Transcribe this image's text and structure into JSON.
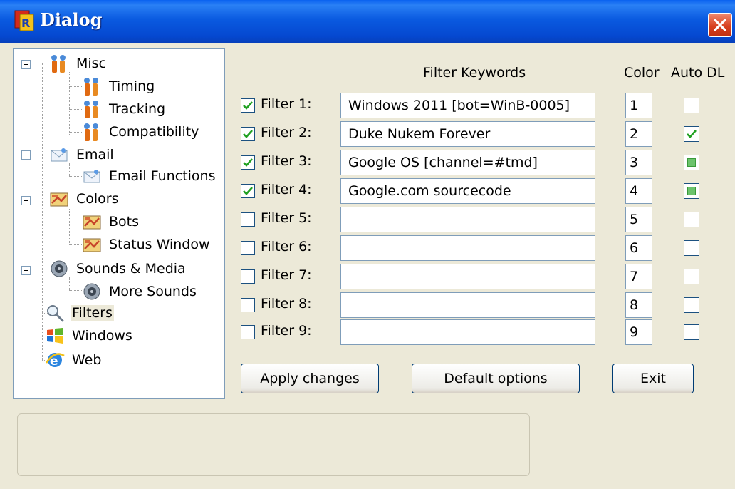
{
  "window": {
    "title": "Dialog"
  },
  "tree": {
    "items": [
      {
        "label": "Misc",
        "icon": "tools-icon"
      },
      {
        "label": "Timing",
        "icon": "tools-icon"
      },
      {
        "label": "Tracking",
        "icon": "tools-icon"
      },
      {
        "label": "Compatibility",
        "icon": "tools-icon"
      },
      {
        "label": "Email",
        "icon": "email-icon"
      },
      {
        "label": "Email Functions",
        "icon": "email-icon"
      },
      {
        "label": "Colors",
        "icon": "colors-icon"
      },
      {
        "label": "Bots",
        "icon": "colors-icon"
      },
      {
        "label": "Status Window",
        "icon": "colors-icon"
      },
      {
        "label": "Sounds & Media",
        "icon": "speaker-icon"
      },
      {
        "label": "More Sounds",
        "icon": "speaker-icon"
      },
      {
        "label": "Filters",
        "icon": "magnifier-icon",
        "selected": true
      },
      {
        "label": "Windows",
        "icon": "windows-flag-icon"
      },
      {
        "label": "Web",
        "icon": "ie-icon"
      }
    ]
  },
  "headers": {
    "keywords": "Filter Keywords",
    "color": "Color",
    "auto_dl": "Auto DL"
  },
  "filters": [
    {
      "label": "Filter 1:",
      "enabled": true,
      "keywords": "Windows 2011 [bot=WinB-0005]",
      "color": "1",
      "auto_dl": "unchecked"
    },
    {
      "label": "Filter 2:",
      "enabled": true,
      "keywords": "Duke Nukem Forever",
      "color": "2",
      "auto_dl": "checked"
    },
    {
      "label": "Filter 3:",
      "enabled": true,
      "keywords": "Google OS [channel=#tmd]",
      "color": "3",
      "auto_dl": "indeterminate"
    },
    {
      "label": "Filter 4:",
      "enabled": true,
      "keywords": "Google.com sourcecode",
      "color": "4",
      "auto_dl": "indeterminate"
    },
    {
      "label": "Filter 5:",
      "enabled": false,
      "keywords": "",
      "color": "5",
      "auto_dl": "unchecked"
    },
    {
      "label": "Filter 6:",
      "enabled": false,
      "keywords": "",
      "color": "6",
      "auto_dl": "unchecked"
    },
    {
      "label": "Filter 7:",
      "enabled": false,
      "keywords": "",
      "color": "7",
      "auto_dl": "unchecked"
    },
    {
      "label": "Filter 8:",
      "enabled": false,
      "keywords": "",
      "color": "8",
      "auto_dl": "unchecked"
    },
    {
      "label": "Filter 9:",
      "enabled": false,
      "keywords": "",
      "color": "9",
      "auto_dl": "unchecked"
    }
  ],
  "buttons": {
    "apply": "Apply changes",
    "defaults": "Default options",
    "exit": "Exit"
  },
  "colors": {
    "titlebar": "#0a5ae0",
    "check": "#21a121",
    "indeterminate": "#6cc36c",
    "close": "#d8401e"
  }
}
